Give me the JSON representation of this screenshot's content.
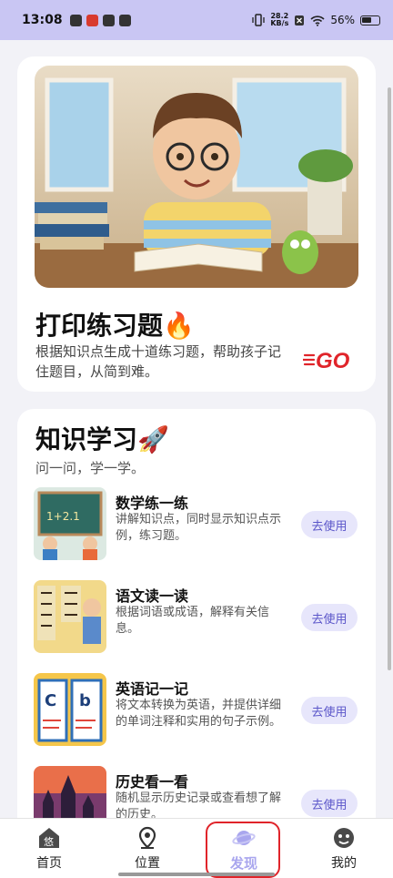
{
  "status_bar": {
    "time": "13:08",
    "net_speed_value": "28.2",
    "net_speed_unit": "KB/s",
    "battery": "56%"
  },
  "hero": {
    "title": "打印练习题🔥",
    "description": "根据知识点生成十道练习题，帮助孩子记住题目，从简到难。",
    "badge": "GO"
  },
  "learning": {
    "title": "知识学习🚀",
    "subtitle": "问一问，学一学。",
    "items": [
      {
        "title": "数学练一练",
        "description": "讲解知识点，同时显示知识点示例，练习题。",
        "button": "去使用"
      },
      {
        "title": "语文读一读",
        "description": "根据词语或成语，解释有关信息。",
        "button": "去使用"
      },
      {
        "title": "英语记一记",
        "description": "将文本转换为英语，并提供详细的单词注释和实用的句子示例。",
        "button": "去使用"
      },
      {
        "title": "历史看一看",
        "description": "随机显示历史记录或查看想了解的历史。",
        "button": "去使用"
      }
    ]
  },
  "bottom_nav": {
    "items": [
      {
        "label": "首页",
        "icon": "home-icon"
      },
      {
        "label": "位置",
        "icon": "location-pin-icon"
      },
      {
        "label": "发现",
        "icon": "planet-icon"
      },
      {
        "label": "我的",
        "icon": "profile-icon"
      }
    ],
    "active": "发现"
  },
  "colors": {
    "accent": "#a9a6ee",
    "status_bar_bg": "#c9c6f3",
    "button_bg": "#e7e6fb",
    "button_text": "#5a55c9",
    "highlight_box": "#e0242a"
  }
}
